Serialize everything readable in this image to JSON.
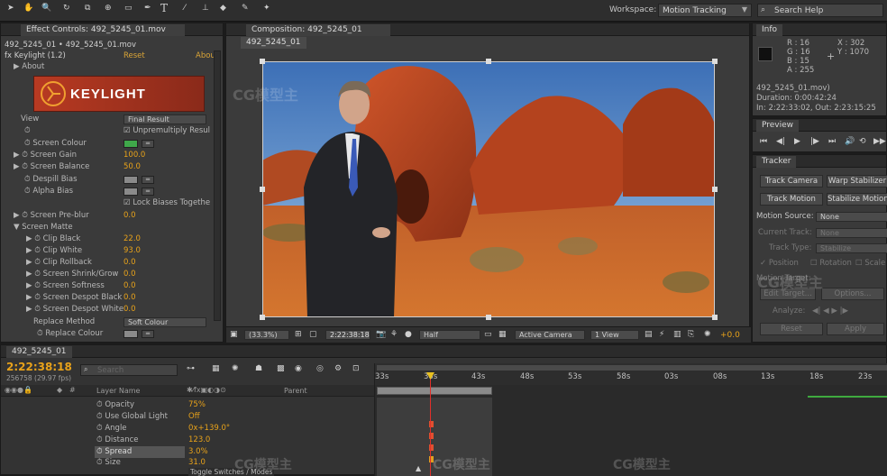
{
  "toolbar": {
    "workspace_label": "Workspace:",
    "workspace_value": "Motion Tracking",
    "search_placeholder": "Search Help"
  },
  "effect_controls": {
    "tab": "Effect Controls: 492_5245_01.mov",
    "breadcrumb": "492_5245_01 • 492_5245_01.mov",
    "effect_name": "Keylight (1.2)",
    "reset": "Reset",
    "about_link": "Abou",
    "about": "About",
    "logo": "KEYLIGHT",
    "view_label": "View",
    "view_value": "Final Result",
    "unpremultiply": "Unpremultiply Resul",
    "screen_colour": "Screen Colour",
    "screen_gain": "Screen Gain",
    "screen_gain_val": "100.0",
    "screen_balance": "Screen Balance",
    "screen_balance_val": "50.0",
    "despill_bias": "Despill Bias",
    "alpha_bias": "Alpha Bias",
    "lock_biases": "Lock Biases Togethe",
    "screen_preblur": "Screen Pre-blur",
    "screen_preblur_val": "0.0",
    "screen_matte": "Screen Matte",
    "clip_black": "Clip Black",
    "clip_black_val": "22.0",
    "clip_white": "Clip White",
    "clip_white_val": "93.0",
    "clip_rollback": "Clip Rollback",
    "clip_rollback_val": "0.0",
    "shrink_grow": "Screen Shrink/Grow",
    "shrink_grow_val": "0.0",
    "softness": "Screen Softness",
    "softness_val": "0.0",
    "despot_black": "Screen Despot Black",
    "despot_black_val": "0.0",
    "despot_white": "Screen Despot White",
    "despot_white_val": "0.0",
    "replace_method": "Replace Method",
    "replace_method_val": "Soft Colour",
    "replace_colour": "Replace Colour"
  },
  "composition": {
    "tab": "Composition: 492_5245_01",
    "subtab": "492_5245_01",
    "zoom": "(33.3%)",
    "timecode": "2:22:38:18",
    "resolution": "Half",
    "camera": "Active Camera",
    "view": "1 View",
    "exposure": "+0.0"
  },
  "info": {
    "tab": "Info",
    "r": "R : 16",
    "g": "G : 16",
    "b": "B : 15",
    "a": "A : 255",
    "x": "X : 302",
    "y": "Y : 1070",
    "file": "492_5245_01.mov)",
    "duration": "Duration: 0:00:42:24",
    "in_out": "In: 2:22:33:02, Out: 2:23:15:25"
  },
  "preview": {
    "tab": "Preview"
  },
  "tracker": {
    "tab": "Tracker",
    "track_camera": "Track Camera",
    "warp_stabilizer": "Warp Stabilizer",
    "track_motion": "Track Motion",
    "stabilize_motion": "Stabilize Motion",
    "motion_source_label": "Motion Source:",
    "motion_source_val": "None",
    "current_track_label": "Current Track:",
    "current_track_val": "None",
    "track_type_label": "Track Type:",
    "track_type_val": "Stabilize",
    "position": "Position",
    "rotation": "Rotation",
    "scale": "Scale",
    "motion_target": "Motion Target:",
    "edit_target": "Edit Target...",
    "options": "Options...",
    "analyze": "Analyze:",
    "reset": "Reset",
    "apply": "Apply"
  },
  "timeline": {
    "tab": "492_5245_01",
    "timecode": "2:22:38:18",
    "frame_info": "256758 (29.97 fps)",
    "search_placeholder": "Search",
    "col_layer_name": "Layer Name",
    "col_parent": "Parent",
    "toggle": "Toggle Switches / Modes",
    "ticks": [
      "33s",
      "38s",
      "43s",
      "48s",
      "53s",
      "58s",
      "03s",
      "08s",
      "13s",
      "18s",
      "23s"
    ],
    "props": [
      {
        "name": "Opacity",
        "value": "75%"
      },
      {
        "name": "Use Global Light",
        "value": "Off"
      },
      {
        "name": "Angle",
        "value": "0x+139.0°"
      },
      {
        "name": "Distance",
        "value": "123.0"
      },
      {
        "name": "Spread",
        "value": "3.0%"
      },
      {
        "name": "Size",
        "value": "31.0"
      }
    ]
  },
  "watermark": "CG模型主"
}
